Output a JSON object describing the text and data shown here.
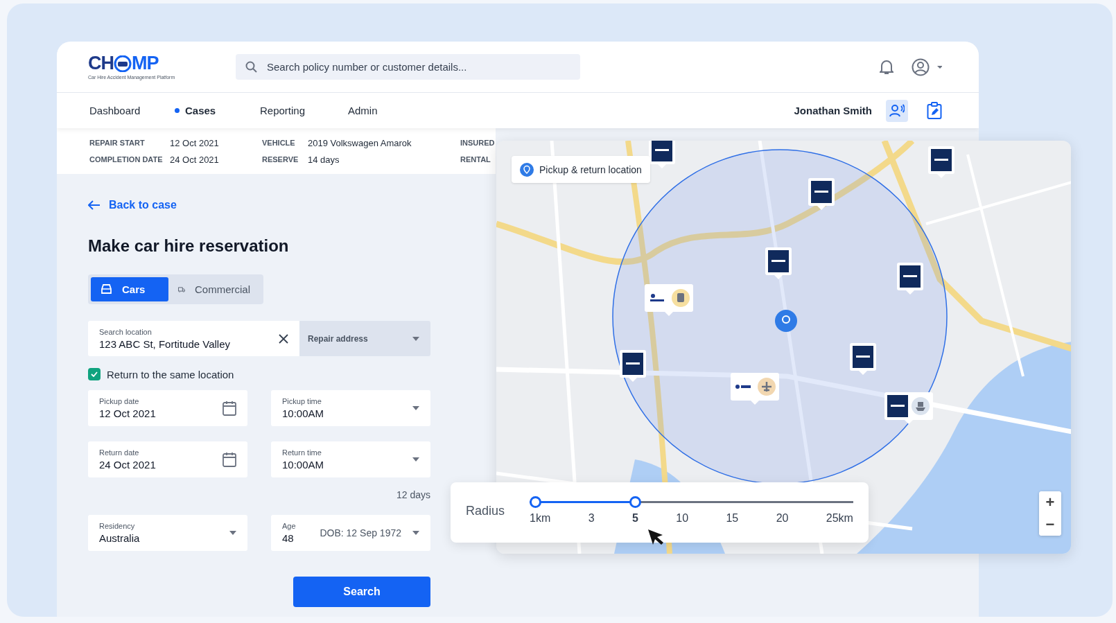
{
  "header": {
    "logo": {
      "left": "CH",
      "right": "MP",
      "tagline": "Car Hire Accident Management Platform"
    },
    "search": {
      "placeholder": "Search policy number or customer details..."
    }
  },
  "nav": {
    "tabs": [
      {
        "label": "Dashboard",
        "selected": false
      },
      {
        "label": "Cases",
        "selected": true
      },
      {
        "label": "Reporting",
        "selected": false
      },
      {
        "label": "Admin",
        "selected": false
      }
    ],
    "user": "Jonathan Smith"
  },
  "summary": [
    {
      "label": "REPAIR START",
      "value": "12 Oct 2021"
    },
    {
      "label": "COMPLETION DATE",
      "value": "24 Oct 2021"
    },
    {
      "label": "VEHICLE",
      "value": "2019 Volkswagen Amarok"
    },
    {
      "label": "RESERVE",
      "value": "14 days"
    },
    {
      "label": "INSURED"
    },
    {
      "label": "RENTAL"
    }
  ],
  "form": {
    "back_link": "Back to case",
    "title": "Make car hire reservation",
    "vehicle_types": [
      {
        "label": "Cars",
        "selected": true,
        "kind": "car"
      },
      {
        "label": "Commercial",
        "selected": false,
        "kind": "truck"
      }
    ],
    "location": {
      "label": "Search location",
      "value": "123 ABC St, Fortitude Valley"
    },
    "address_type": {
      "value": "Repair address"
    },
    "same_location": {
      "label": "Return to the same location",
      "checked": true
    },
    "fields": [
      {
        "label": "Pickup date",
        "value": "12 Oct 2021",
        "kind": "date"
      },
      {
        "label": "Pickup time",
        "value": "10:00AM",
        "kind": "select"
      },
      {
        "label": "Return date",
        "value": "24 Oct 2021",
        "kind": "date"
      },
      {
        "label": "Return time",
        "value": "10:00AM",
        "kind": "select"
      }
    ],
    "duration": "12 days",
    "residency": {
      "label": "Residency",
      "value": "Australia"
    },
    "age": {
      "label": "Age",
      "value": "48",
      "note": "DOB: 12 Sep 1972"
    },
    "search_button": "Search"
  },
  "map": {
    "location_label": "Pickup & return location",
    "zoom": [
      "+",
      "−"
    ],
    "radius": {
      "label": "Radius",
      "level": 0.32,
      "ticks": [
        {
          "label": "1km",
          "selected": false
        },
        {
          "label": "3",
          "selected": false
        },
        {
          "label": "5",
          "selected": true
        },
        {
          "label": "10",
          "selected": false
        },
        {
          "label": "15",
          "selected": false
        },
        {
          "label": "20",
          "selected": false
        },
        {
          "label": "25km",
          "selected": false
        }
      ]
    }
  }
}
